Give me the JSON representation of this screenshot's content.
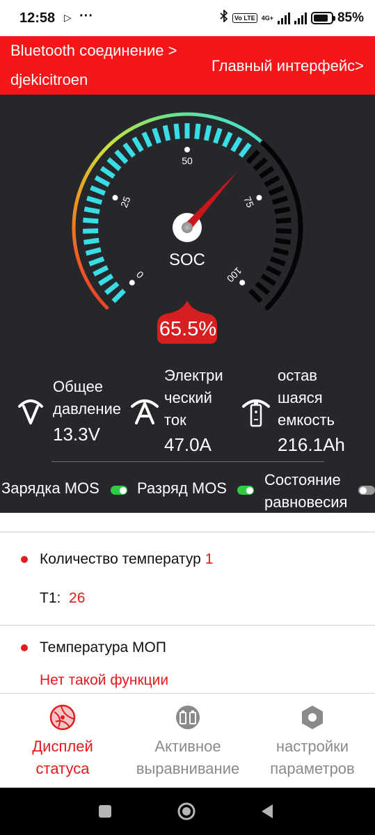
{
  "status_bar": {
    "time": "12:58",
    "battery_pct": "85%",
    "battery_level": 0.85,
    "network": "4G+",
    "volte": "Vo LTE"
  },
  "header": {
    "bluetooth_label": "Bluetooth соединение >",
    "device_name": "djekicitroen",
    "main_interface": "Главный интерфейс>"
  },
  "gauge": {
    "label": "SOC",
    "value_text": "65.5%",
    "value": 65.5,
    "ticks": [
      "0",
      "25",
      "50",
      "75",
      "100"
    ]
  },
  "metrics": [
    {
      "icon": "voltage-icon",
      "label_lines": [
        "Общее",
        "давление"
      ],
      "value": "13.3V"
    },
    {
      "icon": "current-icon",
      "label_lines": [
        "Электри",
        "ческий",
        "ток"
      ],
      "value": "47.0A"
    },
    {
      "icon": "battery-capacity-icon",
      "label_lines": [
        "остав",
        "шаяся",
        "емкость"
      ],
      "value": "216.1Ah"
    }
  ],
  "mos": {
    "charge_label": "Зарядка MOS",
    "charge_on": true,
    "discharge_label": "Разряд MOS",
    "discharge_on": true,
    "balance_label_1": "Состояние",
    "balance_label_2": "равновесия",
    "balance_on": false
  },
  "temperature": {
    "count_label": "Количество температур",
    "count_value": "1",
    "t1_label": "T1:",
    "t1_value": "26"
  },
  "mop": {
    "title": "Температура МОП",
    "value": "Нет такой функции"
  },
  "bottom_nav": [
    {
      "icon": "status-display-icon",
      "line1": "Дисплей",
      "line2": "статуса",
      "active": true
    },
    {
      "icon": "active-balance-icon",
      "line1": "Активное",
      "line2": "выравнивание",
      "active": false
    },
    {
      "icon": "settings-icon",
      "line1": "настройки",
      "line2": "параметров",
      "active": false
    }
  ],
  "colors": {
    "accent_red": "#f5161a",
    "panel_dark": "#25272a",
    "gauge_cyan": "#39dde6",
    "toggle_green": "#2ecc40"
  }
}
